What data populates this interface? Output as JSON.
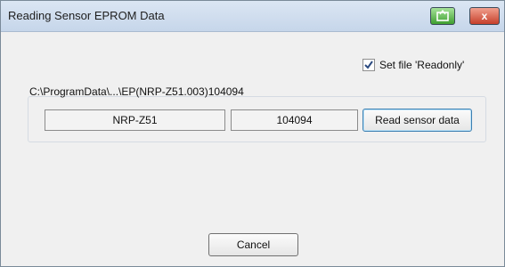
{
  "window": {
    "title": "Reading Sensor EPROM Data",
    "close_glyph": "x"
  },
  "options": {
    "readonly_label": "Set file  'Readonly'",
    "readonly_checked": true
  },
  "sensor": {
    "file_path": "C:\\ProgramData\\...\\EP(NRP-Z51.003)104094",
    "model": "NRP-Z51",
    "serial": "104094",
    "read_button_label": "Read sensor data"
  },
  "footer": {
    "cancel_label": "Cancel"
  }
}
